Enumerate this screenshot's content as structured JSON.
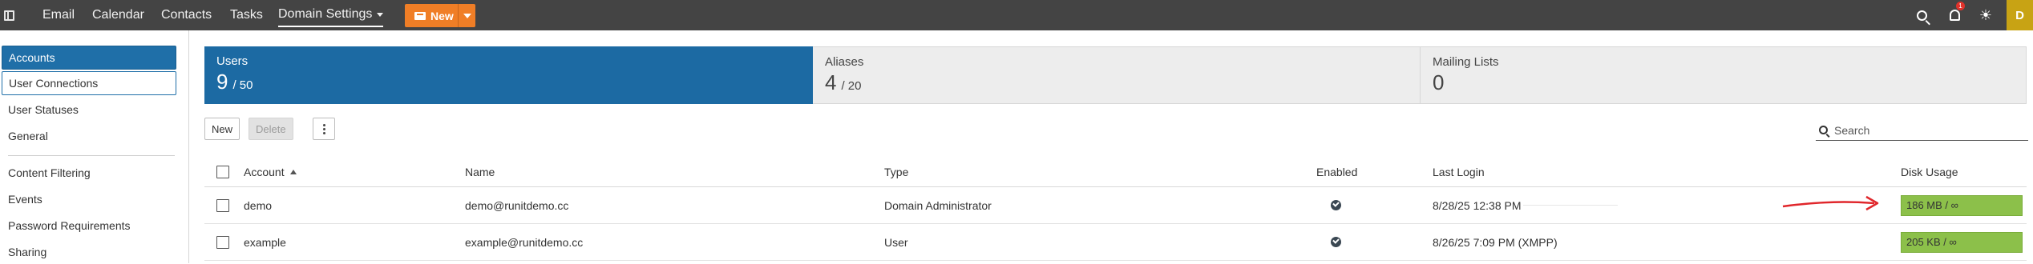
{
  "topbar": {
    "nav": [
      "Email",
      "Calendar",
      "Contacts",
      "Tasks",
      "Domain Settings"
    ],
    "new_label": "New",
    "notification_count": "1",
    "avatar_initial": "D"
  },
  "sidebar": {
    "items": [
      "Accounts",
      "User Connections",
      "User Statuses",
      "General",
      "Content Filtering",
      "Events",
      "Password Requirements",
      "Sharing"
    ]
  },
  "cards": [
    {
      "title": "Users",
      "count": "9",
      "total": "/ 50"
    },
    {
      "title": "Aliases",
      "count": "4",
      "total": "/ 20"
    },
    {
      "title": "Mailing Lists",
      "count": "0",
      "total": ""
    }
  ],
  "toolbar": {
    "new_label": "New",
    "delete_label": "Delete",
    "search_placeholder": "Search"
  },
  "table": {
    "columns": [
      "Account",
      "Name",
      "Type",
      "Enabled",
      "Last Login",
      "Disk Usage"
    ],
    "rows": [
      {
        "account": "demo",
        "name": "demo@runitdemo.cc",
        "type": "Domain Administrator",
        "enabled": true,
        "last_login": "8/28/25 12:38 PM",
        "disk": "186 MB / ∞"
      },
      {
        "account": "example",
        "name": "example@runitdemo.cc",
        "type": "User",
        "enabled": true,
        "last_login": "8/26/25 7:09 PM (XMPP)",
        "disk": "205 KB / ∞"
      }
    ]
  },
  "colors": {
    "accent": "#1c6aa3",
    "new_button": "#f07e26",
    "disk_bar": "#8cc04a",
    "annotation_arrow": "#e0262b"
  }
}
